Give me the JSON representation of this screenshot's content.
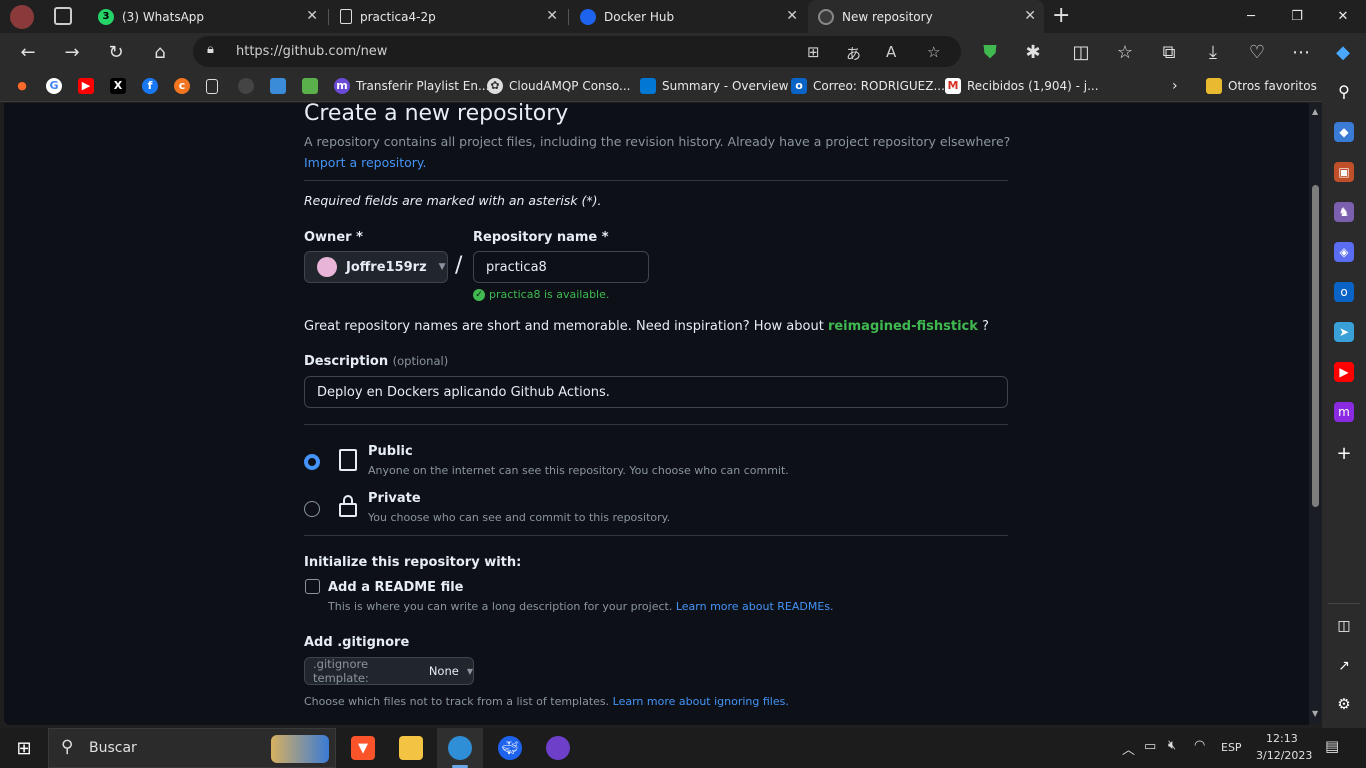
{
  "tabs": [
    {
      "title": "(3) WhatsApp",
      "badge": "3"
    },
    {
      "title": "practica4-2p"
    },
    {
      "title": "Docker Hub"
    },
    {
      "title": "New repository"
    }
  ],
  "address": {
    "url": "https://github.com/new"
  },
  "favorites": [
    {
      "label": "Transferir Playlist En..."
    },
    {
      "label": "CloudAMQP Conso..."
    },
    {
      "label": "Summary - Overview"
    },
    {
      "label": "Correo: RODRIGUEZ..."
    },
    {
      "label": "Recibidos (1,904) - j..."
    },
    {
      "label": "Otros favoritos"
    }
  ],
  "page": {
    "title": "Create a new repository",
    "subtitle": "A repository contains all project files, including the revision history. Already have a project repository elsewhere?",
    "import_link": "Import a repository.",
    "required_note": "Required fields are marked with an asterisk (*).",
    "owner_label": "Owner *",
    "owner_value": "Joffre159rz",
    "slash": "/",
    "repo_label": "Repository name *",
    "repo_value": "practica8",
    "availability": "practica8 is available.",
    "inspiration_text": "Great repository names are short and memorable. Need inspiration? How about",
    "inspiration_name": "reimagined-fishstick",
    "inspiration_end": "?",
    "description_label": "Description",
    "description_optional": "(optional)",
    "description_value": "Deploy en Dockers aplicando Github Actions.",
    "public_label": "Public",
    "public_desc": "Anyone on the internet can see this repository. You choose who can commit.",
    "private_label": "Private",
    "private_desc": "You choose who can see and commit to this repository.",
    "init_label": "Initialize this repository with:",
    "readme_label": "Add a README file",
    "readme_desc": "This is where you can write a long description for your project.",
    "readme_link": "Learn more about READMEs.",
    "gitignore_label": "Add .gitignore",
    "gitignore_prefix": ".gitignore template:",
    "gitignore_value": "None",
    "gitignore_desc": "Choose which files not to track from a list of templates.",
    "gitignore_link": "Learn more about ignoring files."
  },
  "taskbar": {
    "search": "Buscar",
    "lang": "ESP",
    "time": "12:13",
    "date": "3/12/2023"
  },
  "colors": {
    "accent_blue": "#4493f8",
    "success_green": "#3fb950",
    "page_bg": "#0d1117"
  }
}
